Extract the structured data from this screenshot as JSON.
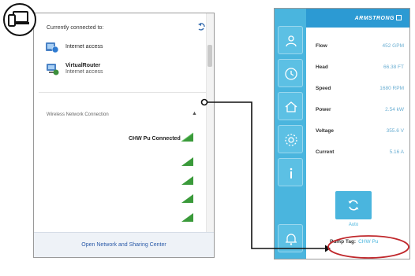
{
  "flyout": {
    "header": "Currently connected to:",
    "connections": [
      {
        "name": "Internet access",
        "sub": ""
      },
      {
        "name": "VirtualRouter",
        "sub": "Internet access"
      }
    ],
    "section_label": "Wireless Network Connection",
    "connected_network": "CHW Pu Connected",
    "footer_link": "Open Network and Sharing Center"
  },
  "pump": {
    "brand": "ARMSTRONG",
    "rows": [
      {
        "label": "Flow",
        "value": "452 GPM"
      },
      {
        "label": "Head",
        "value": "66.38 FT"
      },
      {
        "label": "Speed",
        "value": "1680 RPM"
      },
      {
        "label": "Power",
        "value": "2.54 kW"
      },
      {
        "label": "Voltage",
        "value": "355.6 V"
      },
      {
        "label": "Current",
        "value": "5.16 A"
      }
    ],
    "auto_label": "Auto",
    "pump_tag_label": "Pump Tag:",
    "pump_tag_value": "CHW Pu"
  },
  "colors": {
    "pump_blue": "#4ab5de",
    "header_blue": "#2c9ad3",
    "highlight_red": "#c0282c",
    "signal_green": "#3a9a3a"
  }
}
